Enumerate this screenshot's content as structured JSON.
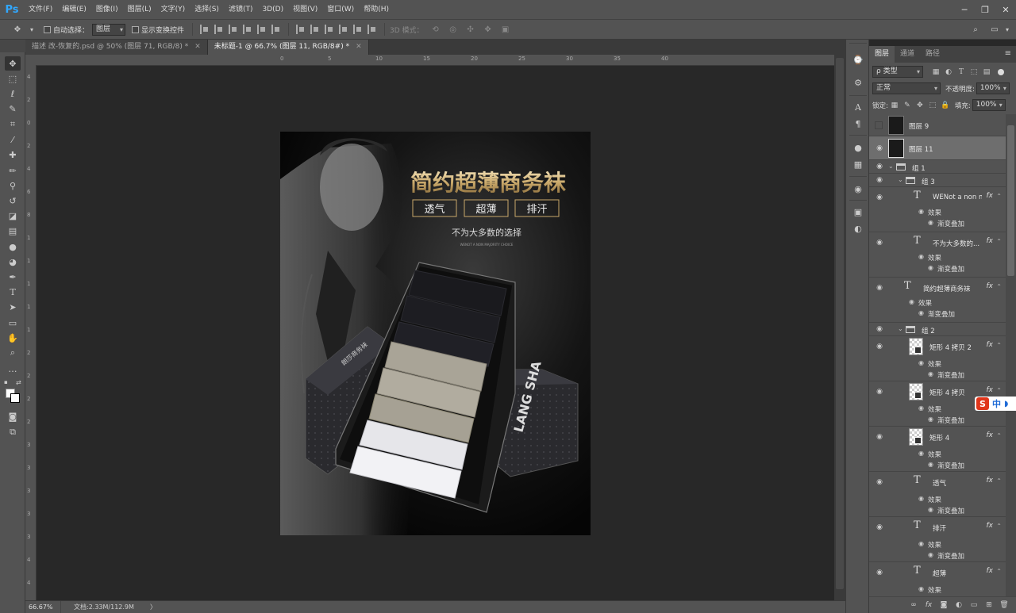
{
  "app": {
    "logo": "Ps",
    "menu": [
      "文件(F)",
      "编辑(E)",
      "图像(I)",
      "图层(L)",
      "文字(Y)",
      "选择(S)",
      "滤镜(T)",
      "3D(D)",
      "视图(V)",
      "窗口(W)",
      "帮助(H)"
    ]
  },
  "options_bar": {
    "auto_select_label": "自动选择：",
    "auto_select_value": "图层",
    "show_transform_label": "显示变换控件",
    "mode_3d_label": "3D 模式："
  },
  "tabs": [
    {
      "title": "描述 改-恢复的.psd @ 50% (图层 71, RGB/8) *",
      "active": false
    },
    {
      "title": "未标题-1 @ 66.7% (图层 11, RGB/8#) *",
      "active": true
    }
  ],
  "status": {
    "zoom": "66.67%",
    "doc_info": "文档:2.33M/112.9M",
    "arrow": "〉"
  },
  "ruler": {
    "top_ticks": [
      "0",
      "5",
      "10",
      "15",
      "20",
      "25",
      "30",
      "35",
      "40"
    ],
    "left_ticks": [
      "4",
      "2",
      "0",
      "2",
      "4",
      "6",
      "8",
      "1",
      "1",
      "1",
      "1",
      "1",
      "2",
      "2",
      "2",
      "2",
      "3",
      "3",
      "3",
      "3",
      "3",
      "4",
      "4"
    ]
  },
  "layers_panel": {
    "tabs": [
      "图层",
      "通道",
      "路径"
    ],
    "filter_kind": "ρ 类型",
    "blend_mode": "正常",
    "opacity_label": "不透明度:",
    "opacity_value": "100%",
    "lock_label": "锁定:",
    "fill_label": "填充:",
    "fill_value": "100%",
    "effect_label": "效果",
    "gradient_overlay": "渐变叠加",
    "layers": [
      {
        "name": "图层 9"
      },
      {
        "name": "图层 11"
      },
      {
        "name": "组 1"
      },
      {
        "name": "组 3"
      },
      {
        "name": "WENot a non m..."
      },
      {
        "name": "不为大多数的..."
      },
      {
        "name": "简约超薄商务袜"
      },
      {
        "name": "组 2"
      },
      {
        "name": "矩形 4 拷贝 2"
      },
      {
        "name": "矩形 4 拷贝"
      },
      {
        "name": "矩形 4"
      },
      {
        "name": "透气"
      },
      {
        "name": "排汗"
      },
      {
        "name": "超薄"
      }
    ]
  },
  "ime": {
    "brand": "S",
    "lang": "中",
    "mode": "◗"
  },
  "artwork": {
    "headline": "简约超薄商务袜",
    "tags": [
      "透气",
      "超薄",
      "排汗"
    ],
    "slogan": "不为大多数的选择",
    "slogan_en": "WENOT A NON MAJORITY CHOICE",
    "brand": "LANG SHA",
    "box_text": "朗莎商务袜"
  },
  "colors": {
    "chrome": "#535353",
    "canvas_bg": "#282828",
    "accent_gold": "#c9a86a",
    "ps_blue": "#31a8ff"
  }
}
